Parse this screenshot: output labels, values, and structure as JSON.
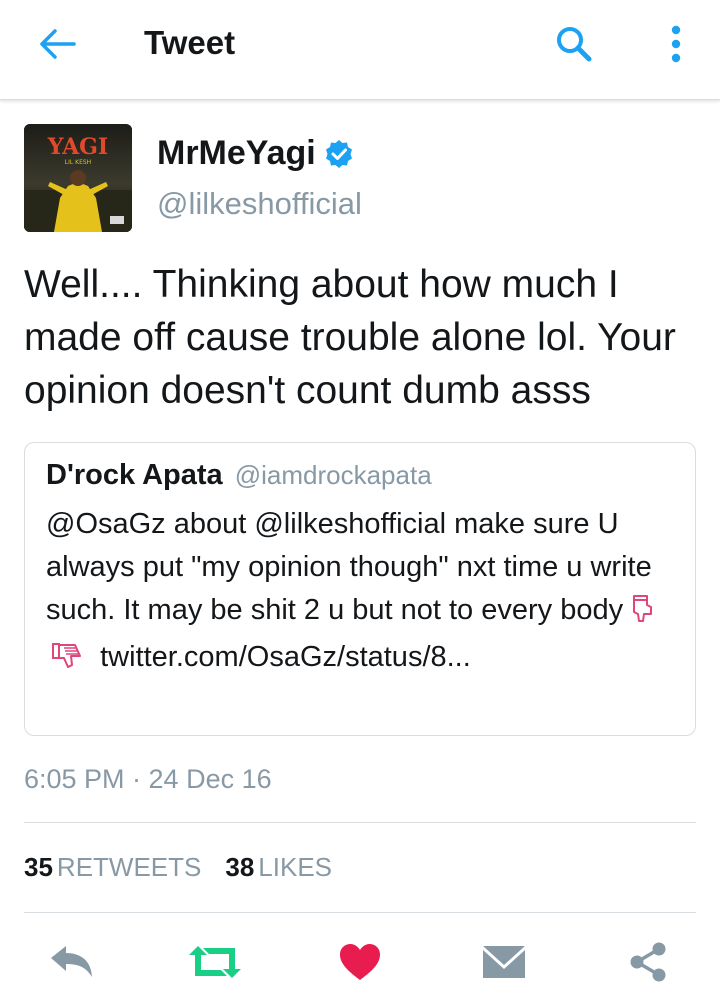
{
  "header": {
    "title": "Tweet",
    "back_icon": "arrow-left-icon",
    "search_icon": "search-icon",
    "more_icon": "more-vertical-icon",
    "accent_color": "#1da1f2"
  },
  "tweet": {
    "display_name": "MrMeYagi",
    "verified": true,
    "handle": "@lilkeshofficial",
    "avatar": {
      "title": "YAGI",
      "subtitle": "LIL KESH"
    },
    "text": "Well.... Thinking about how much I made off cause trouble alone lol. Your opinion doesn't count dumb asss",
    "timestamp": "6:05 PM · 24 Dec 16"
  },
  "quote": {
    "name": "D'rock Apata",
    "handle": "@iamdrockapata",
    "text": "@OsaGz  about @lilkeshofficial make sure U always put \"my opinion though\" nxt time u write such. It may be shit 2 u but not to every body",
    "emojis": [
      "pointing-down-icon",
      "thumbs-down-icon"
    ],
    "link": "twitter.com/OsaGz/status/8..."
  },
  "stats": {
    "retweets_count": "35",
    "retweets_label": "RETWEETS",
    "likes_count": "38",
    "likes_label": "LIKES"
  },
  "actions": [
    {
      "name": "reply",
      "icon": "reply-icon",
      "color": "#8899a6"
    },
    {
      "name": "retweet",
      "icon": "retweet-icon",
      "color": "#19cf86"
    },
    {
      "name": "like",
      "icon": "heart-icon",
      "color": "#e81c4f"
    },
    {
      "name": "direct-message",
      "icon": "envelope-icon",
      "color": "#8899a6"
    },
    {
      "name": "share",
      "icon": "share-icon",
      "color": "#8899a6"
    }
  ]
}
